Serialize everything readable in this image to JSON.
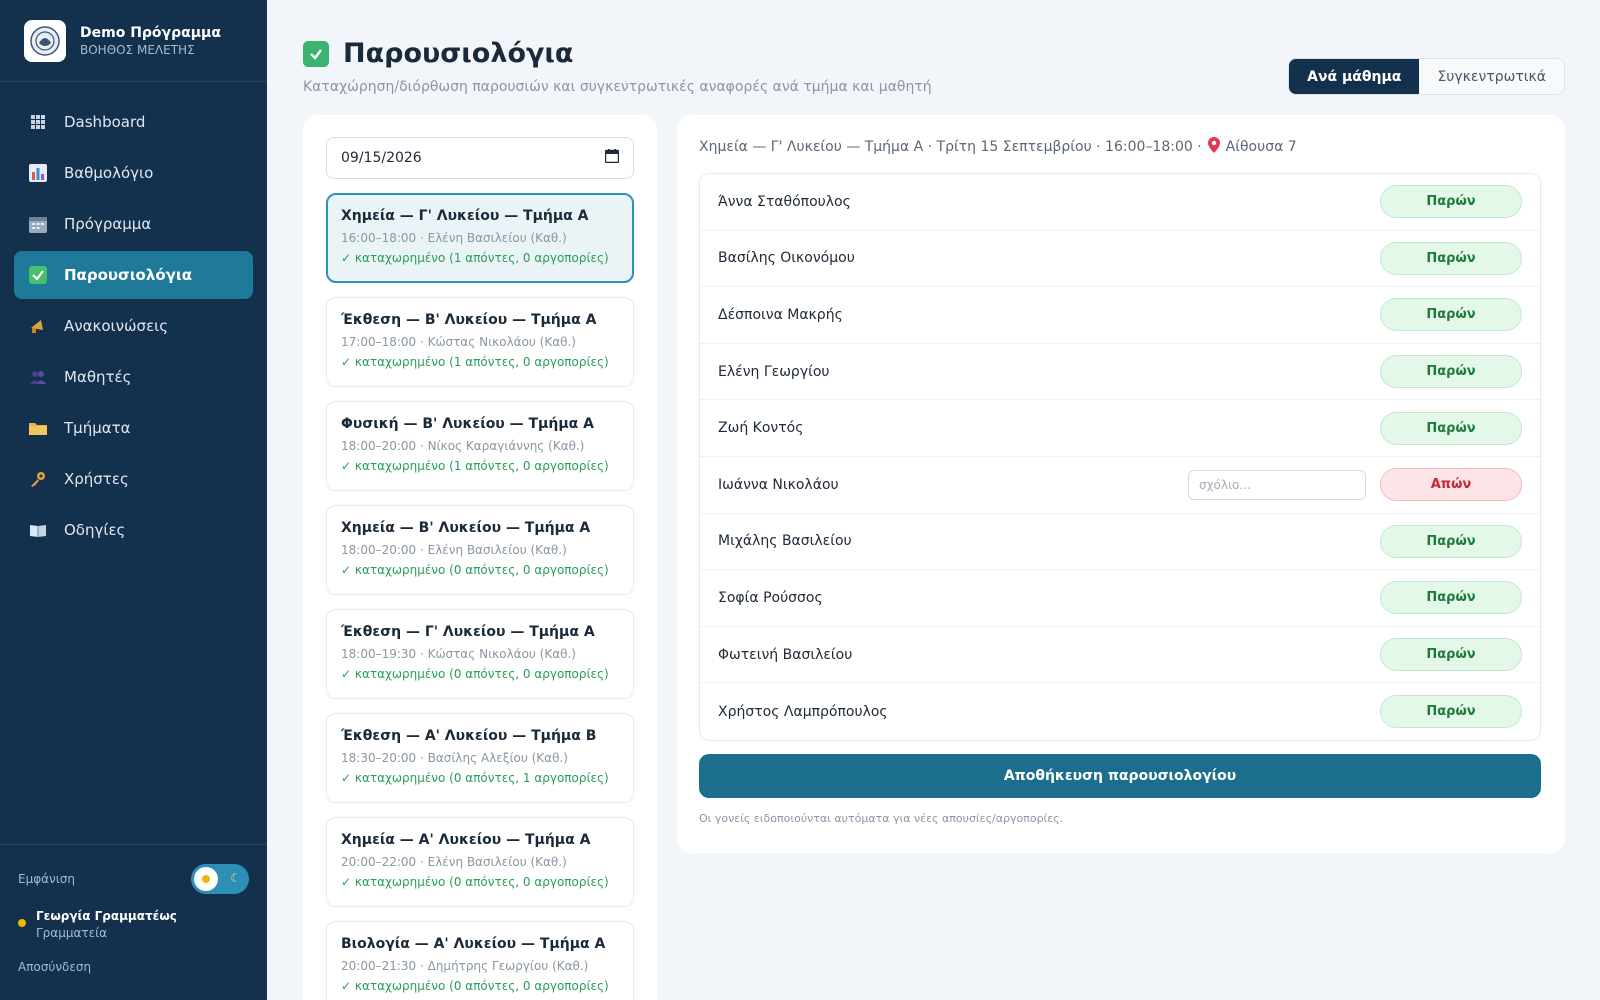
{
  "brand": {
    "title": "Demo Πρόγραμμα",
    "subtitle": "ΒΟΗΘΟΣ ΜΕΛΕΤΗΣ"
  },
  "nav": [
    {
      "label": "Dashboard",
      "icon": "grid-icon"
    },
    {
      "label": "Βαθμολόγιο",
      "icon": "bar-chart-icon"
    },
    {
      "label": "Πρόγραμμα",
      "icon": "calendar-icon"
    },
    {
      "label": "Παρουσιολόγια",
      "icon": "checkbox-icon",
      "active": true
    },
    {
      "label": "Ανακοινώσεις",
      "icon": "megaphone-icon"
    },
    {
      "label": "Μαθητές",
      "icon": "people-icon"
    },
    {
      "label": "Τμήματα",
      "icon": "folder-icon"
    },
    {
      "label": "Χρήστες",
      "icon": "key-icon"
    },
    {
      "label": "Οδηγίες",
      "icon": "book-icon"
    }
  ],
  "sidebar_footer": {
    "appearance_label": "Εμφάνιση",
    "user_name": "Γεωργία Γραμματέως",
    "user_role": "Γραμματεία",
    "logout_label": "Αποσύνδεση"
  },
  "header": {
    "title": "Παρουσιολόγια",
    "subtitle": "Καταχώρηση/διόρθωση παρουσιών και συγκεντρωτικές αναφορές ανά τμήμα και μαθητή",
    "tabs": [
      "Ανά μάθημα",
      "Συγκεντρωτικά"
    ]
  },
  "date_value": "09/15/2026",
  "lessons": [
    {
      "title": "Χημεία — Γ' Λυκείου — Τμήμα Α",
      "meta": "16:00–18:00 · Ελένη Βασιλείου (Καθ.)",
      "status": "✓ καταχωρημένο (1 απόντες, 0 αργοπορίες)",
      "selected": true
    },
    {
      "title": "Έκθεση — Β' Λυκείου — Τμήμα Α",
      "meta": "17:00–18:00 · Κώστας Νικολάου (Καθ.)",
      "status": "✓ καταχωρημένο (1 απόντες, 0 αργοπορίες)"
    },
    {
      "title": "Φυσική — Β' Λυκείου — Τμήμα Α",
      "meta": "18:00–20:00 · Νίκος Καραγιάννης (Καθ.)",
      "status": "✓ καταχωρημένο (1 απόντες, 0 αργοπορίες)"
    },
    {
      "title": "Χημεία — Β' Λυκείου — Τμήμα Α",
      "meta": "18:00–20:00 · Ελένη Βασιλείου (Καθ.)",
      "status": "✓ καταχωρημένο (0 απόντες, 0 αργοπορίες)"
    },
    {
      "title": "Έκθεση — Γ' Λυκείου — Τμήμα Α",
      "meta": "18:00–19:30 · Κώστας Νικολάου (Καθ.)",
      "status": "✓ καταχωρημένο (0 απόντες, 0 αργοπορίες)"
    },
    {
      "title": "Έκθεση — Α' Λυκείου — Τμήμα Β",
      "meta": "18:30–20:00 · Βασίλης Αλεξίου (Καθ.)",
      "status": "✓ καταχωρημένο (0 απόντες, 1 αργοπορίες)"
    },
    {
      "title": "Χημεία — Α' Λυκείου — Τμήμα Α",
      "meta": "20:00–22:00 · Ελένη Βασιλείου (Καθ.)",
      "status": "✓ καταχωρημένο (0 απόντες, 0 αργοπορίες)"
    },
    {
      "title": "Βιολογία — Α' Λυκείου — Τμήμα Α",
      "meta": "20:00–21:30 · Δημήτρης Γεωργίου (Καθ.)",
      "status": "✓ καταχωρημένο (0 απόντες, 0 αργοπορίες)"
    }
  ],
  "selected_lesson": {
    "header": "Χημεία — Γ' Λυκείου — Τμήμα Α · Τρίτη 15 Σεπτεμβρίου · 16:00–18:00 ·",
    "room": "Αίθουσα 7"
  },
  "comment_placeholder": "σχόλιο...",
  "students": [
    {
      "name": "Άννα Σταθόπουλος",
      "status": "Παρών",
      "state": "present"
    },
    {
      "name": "Βασίλης Οικονόμου",
      "status": "Παρών",
      "state": "present"
    },
    {
      "name": "Δέσποινα Μακρής",
      "status": "Παρών",
      "state": "present"
    },
    {
      "name": "Ελένη Γεωργίου",
      "status": "Παρών",
      "state": "present"
    },
    {
      "name": "Ζωή Κοντός",
      "status": "Παρών",
      "state": "present"
    },
    {
      "name": "Ιωάννα Νικολάου",
      "status": "Απών",
      "state": "absent"
    },
    {
      "name": "Μιχάλης Βασιλείου",
      "status": "Παρών",
      "state": "present"
    },
    {
      "name": "Σοφία Ρούσσος",
      "status": "Παρών",
      "state": "present"
    },
    {
      "name": "Φωτεινή Βασιλείου",
      "status": "Παρών",
      "state": "present"
    },
    {
      "name": "Χρήστος Λαμπρόπουλος",
      "status": "Παρών",
      "state": "present"
    }
  ],
  "save_label": "Αποθήκευση παρουσιολογίου",
  "note": "Οι γονείς ειδοποιούνται αυτόματα για νέες απουσίες/αργοπορίες.",
  "colors": {
    "sidebar_bg": "#13304d",
    "active_nav": "#1f7a99",
    "primary": "#1c6f8c",
    "present": "#1f7a3d",
    "absent": "#c2283a"
  }
}
